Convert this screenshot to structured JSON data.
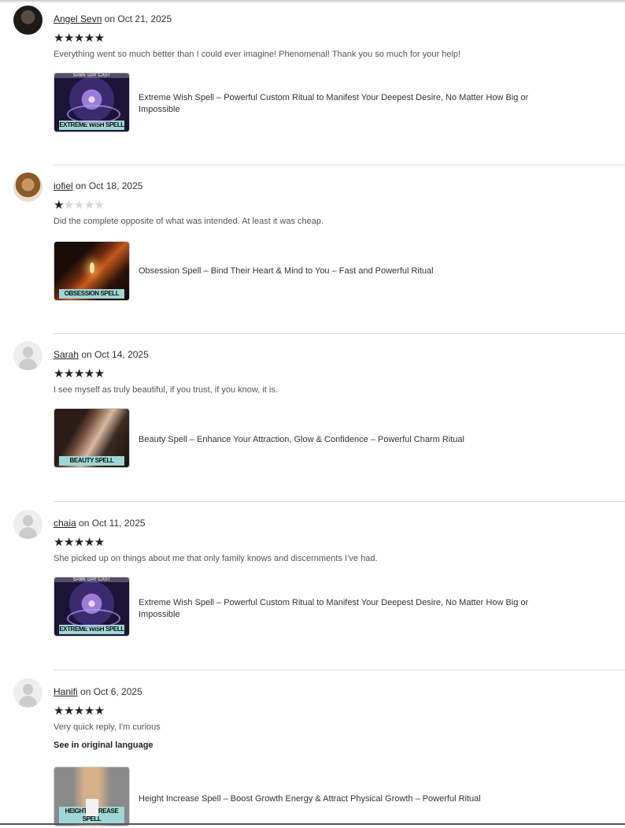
{
  "reviews": [
    {
      "username": "Angel Sevn",
      "date": "on Oct 21, 2025",
      "rating": 5,
      "stars_on": "★★★★★",
      "stars_off": "",
      "text": "Everything went so much better than I could ever imagine! Phenomenal! Thank you so much for your help!",
      "product": {
        "title": "Extreme Wish Spell – Powerful Custom Ritual to Manifest Your Deepest Desire, No Matter How Big or Impossible",
        "thumb_caption": "EXTREME WISH SPELL",
        "thumb_banner": "SAME DAY CAST"
      }
    },
    {
      "username": "iofiel",
      "date": "on Oct 18, 2025",
      "rating": 1,
      "stars_on": "★",
      "stars_off": "★★★★",
      "text": "Did the complete opposite of what was intended. At least it was cheap.",
      "product": {
        "title": "Obsession Spell – Bind Their Heart & Mind to You – Fast and Powerful Ritual",
        "thumb_caption": "OBSESSION SPELL"
      }
    },
    {
      "username": "Sarah",
      "date": "on Oct 14, 2025",
      "rating": 5,
      "stars_on": "★★★★★",
      "stars_off": "",
      "text": "I see myself as truly beautiful, if you trust, if you know, it is.",
      "product": {
        "title": "Beauty Spell – Enhance Your Attraction, Glow & Confidence – Powerful Charm Ritual",
        "thumb_caption": "BEAUTY SPELL"
      }
    },
    {
      "username": "chaia",
      "date": "on Oct 11, 2025",
      "rating": 5,
      "stars_on": "★★★★★",
      "stars_off": "",
      "text": "She picked up on things about me that only family knows and discernments I’ve had.",
      "product": {
        "title": "Extreme Wish Spell – Powerful Custom Ritual to Manifest Your Deepest Desire, No Matter How Big or Impossible",
        "thumb_caption": "EXTREME WISH SPELL",
        "thumb_banner": "SAME DAY CAST"
      }
    },
    {
      "username": "Hanifi",
      "date": "on Oct 6, 2025",
      "rating": 5,
      "stars_on": "★★★★★",
      "stars_off": "",
      "text": "Very quick reply, I'm curious",
      "translate_link": "See in original language",
      "product": {
        "title": "Height Increase Spell – Boost Growth Energy & Attract Physical Growth – Powerful Ritual",
        "thumb_caption": "HEIGHT INCREASE SPELL"
      }
    }
  ],
  "colors": {
    "star_on": "#222222",
    "star_off": "#d6d6d6",
    "caption_bg": "#9fd6d6",
    "divider": "#dcdcdc"
  }
}
